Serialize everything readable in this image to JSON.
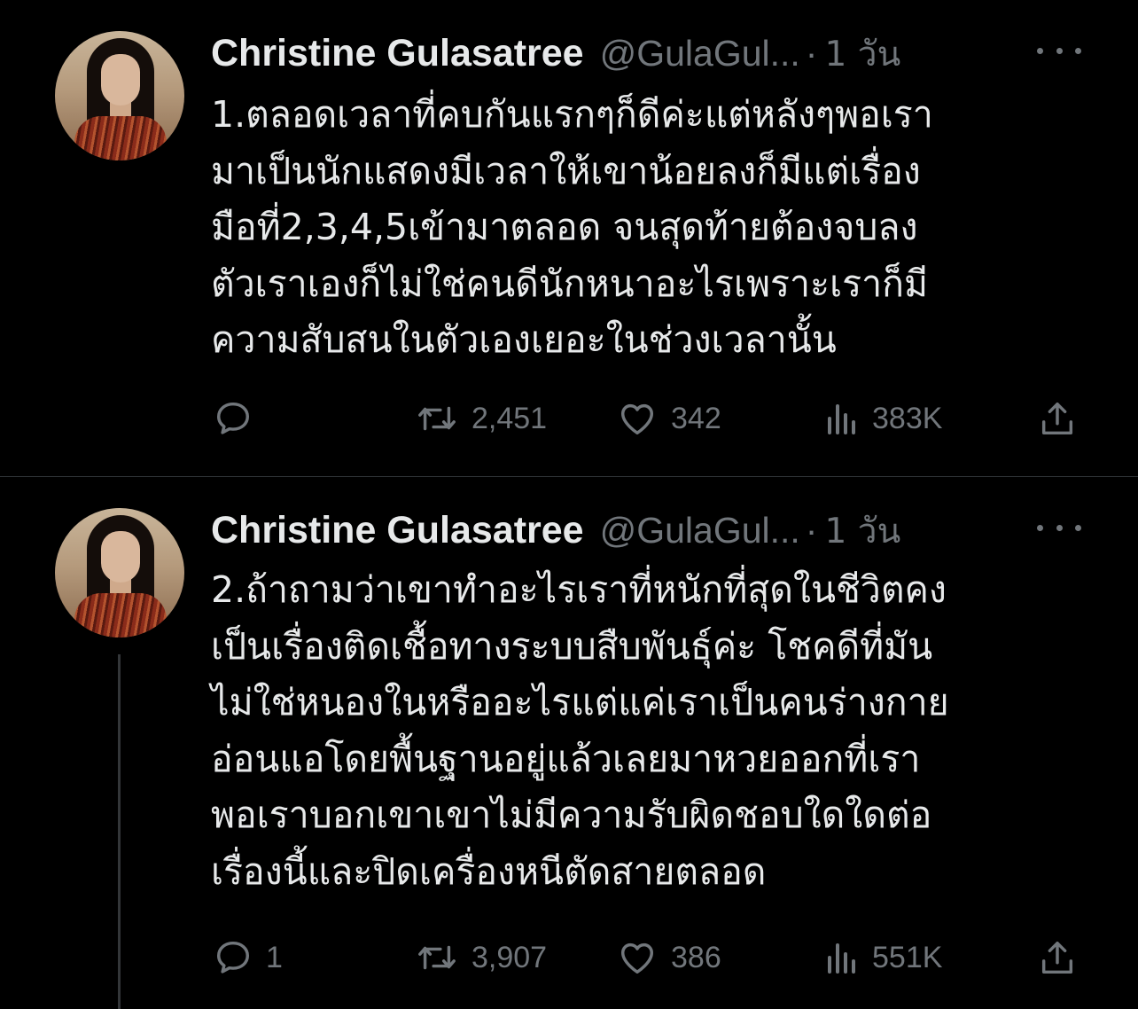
{
  "tweets": [
    {
      "name": "Christine Gulasatree",
      "handle": "@GulaGul...",
      "separator": "·",
      "time": "1 วัน",
      "text_lines": [
        "1.ตลอดเวลาที่คบกันแรกๆก็ดีค่ะแต่หลังๆพอเรา",
        "มาเป็นนักแสดงมีเวลาให้เขาน้อยลงก็มีแต่เรื่อง",
        "มือที่2,3,4,5เข้ามาตลอด จนสุดท้ายต้องจบลง",
        "ตัวเราเองก็ไม่ใช่คนดีนักหนาอะไรเพราะเราก็มี",
        "ความสับสนในตัวเองเยอะในช่วงเวลานั้น"
      ],
      "replies": "",
      "retweets": "2,451",
      "likes": "342",
      "views": "383K"
    },
    {
      "name": "Christine Gulasatree",
      "handle": "@GulaGul...",
      "separator": "·",
      "time": "1 วัน",
      "text_lines": [
        "2.ถ้าถามว่าเขาทำอะไรเราที่หนักที่สุดในชีวิตคง",
        "เป็นเรื่องติดเชื้อทางระบบสืบพันธุ์ค่ะ โชคดีที่มัน",
        "ไม่ใช่หนองในหรืออะไรแต่แค่เราเป็นคนร่างกาย",
        "อ่อนแอโดยพื้นฐานอยู่แล้วเลยมาหวยออกที่เรา",
        "พอเราบอกเขาเขาไม่มีความรับผิดชอบใดใดต่อ",
        "เรื่องนี้และปิดเครื่องหนีตัดสายตลอด"
      ],
      "replies": "1",
      "retweets": "3,907",
      "likes": "386",
      "views": "551K"
    }
  ],
  "icons": {
    "reply": "speech-bubble-icon",
    "retweet": "retweet-icon",
    "like": "heart-icon",
    "views": "bar-chart-icon",
    "share": "share-upload-icon",
    "more": "ellipsis-icon"
  },
  "colors": {
    "background": "#000000",
    "primary_text": "#e7e9ea",
    "secondary_text": "#71767b",
    "divider": "#2f3336"
  }
}
